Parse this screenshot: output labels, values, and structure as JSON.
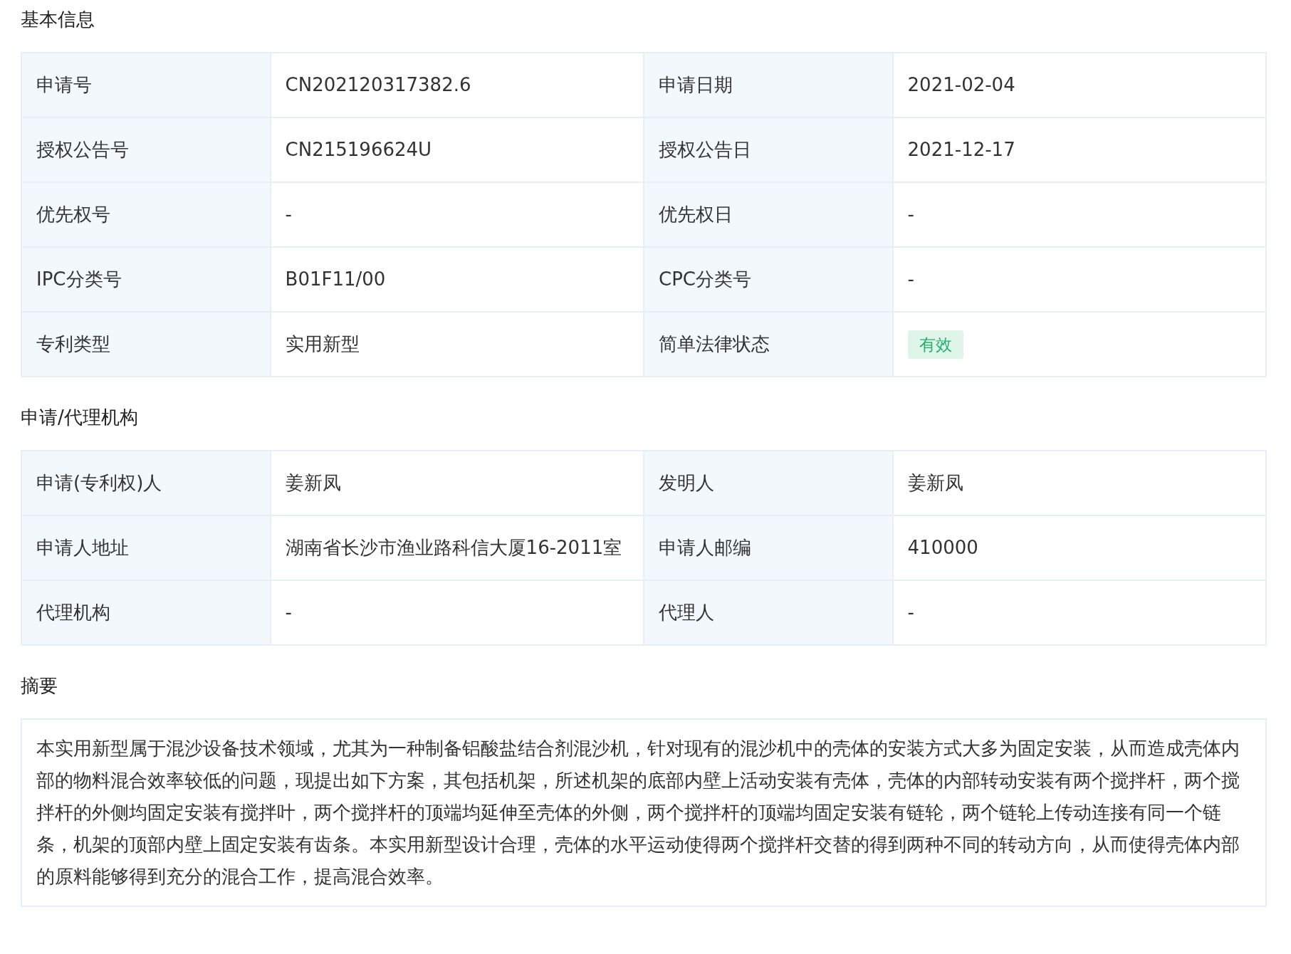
{
  "sections": [
    {
      "kind": "table",
      "title": "基本信息",
      "fields": [
        {
          "label": "申请号",
          "value": "CN202120317382.6",
          "kind": "text"
        },
        {
          "label": "申请日期",
          "value": "2021-02-04",
          "kind": "text"
        },
        {
          "label": "授权公告号",
          "value": "CN215196624U",
          "kind": "text"
        },
        {
          "label": "授权公告日",
          "value": "2021-12-17",
          "kind": "text"
        },
        {
          "label": "优先权号",
          "value": "-",
          "kind": "text"
        },
        {
          "label": "优先权日",
          "value": "-",
          "kind": "text"
        },
        {
          "label": "IPC分类号",
          "value": "B01F11/00",
          "kind": "text"
        },
        {
          "label": "CPC分类号",
          "value": "-",
          "kind": "text"
        },
        {
          "label": "专利类型",
          "value": "实用新型",
          "kind": "text"
        },
        {
          "label": "简单法律状态",
          "value": "有效",
          "kind": "tag"
        }
      ]
    },
    {
      "kind": "table",
      "title": "申请/代理机构",
      "fields": [
        {
          "label": "申请(专利权)人",
          "value": "姜新凤",
          "kind": "text"
        },
        {
          "label": "发明人",
          "value": "姜新凤",
          "kind": "text"
        },
        {
          "label": "申请人地址",
          "value": "湖南省长沙市渔业路科信大厦16-2011室",
          "kind": "text"
        },
        {
          "label": "申请人邮编",
          "value": "410000",
          "kind": "text"
        },
        {
          "label": "代理机构",
          "value": "-",
          "kind": "text"
        },
        {
          "label": "代理人",
          "value": "-",
          "kind": "text"
        }
      ]
    },
    {
      "kind": "text",
      "title": "摘要",
      "text": "本实用新型属于混沙设备技术领域，尤其为一种制备铝酸盐结合剂混沙机，针对现有的混沙机中的壳体的安装方式大多为固定安装，从而造成壳体内部的物料混合效率较低的问题，现提出如下方案，其包括机架，所述机架的底部内壁上活动安装有壳体，壳体的内部转动安装有两个搅拌杆，两个搅拌杆的外侧均固定安装有搅拌叶，两个搅拌杆的顶端均延伸至壳体的外侧，两个搅拌杆的顶端均固定安装有链轮，两个链轮上传动连接有同一个链条，机架的顶部内壁上固定安装有齿条。本实用新型设计合理，壳体的水平运动使得两个搅拌杆交替的得到两种不同的转动方向，从而使得壳体内部的原料能够得到充分的混合工作，提高混合效率。"
    }
  ]
}
